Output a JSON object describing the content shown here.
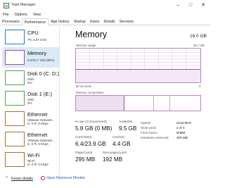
{
  "window": {
    "title": "Task Manager",
    "minimize": "–",
    "maximize": "□",
    "close": "✕"
  },
  "menu": [
    "File",
    "Options",
    "View"
  ],
  "tabs": [
    "Processes",
    "Performance",
    "App history",
    "Startup",
    "Users",
    "Details",
    "Services"
  ],
  "active_tab": "Performance",
  "sidebar": [
    {
      "name": "CPU",
      "sub1": "7%  3.67 GHz",
      "sub2": "",
      "color": "#1f78c1",
      "selected": false
    },
    {
      "name": "Memory",
      "sub1": "6.2/15.7 GB (39%)",
      "sub2": "",
      "color": "#9b4aa8",
      "selected": true
    },
    {
      "name": "Disk 0 (C: D:)",
      "sub1": "SSD",
      "sub2": "2%",
      "color": "#4da34d",
      "selected": false
    },
    {
      "name": "Disk 1 (E:)",
      "sub1": "SSD",
      "sub2": "0%",
      "color": "#4da34d",
      "selected": false
    },
    {
      "name": "Ethernet",
      "sub1": "VMware Network...",
      "sub2": "S: 0  R: 0 Kbps",
      "color": "#b06a2c",
      "selected": false
    },
    {
      "name": "Ethernet",
      "sub1": "VMware Network...",
      "sub2": "S: 0  R: 0 Kbps",
      "color": "#b06a2c",
      "selected": false
    },
    {
      "name": "Wi-Fi",
      "sub1": "Wi-Fi",
      "sub2": "S: 0  R: 0 Kbps",
      "color": "#b06a2c",
      "selected": false
    }
  ],
  "footer": {
    "fewer_details": "Fewer details",
    "open_resource_monitor": "Open Resource Monitor"
  },
  "main": {
    "title": "Memory",
    "total": "16.0 GB",
    "usage_label": "Memory usage",
    "usage_max": "15.7 GB",
    "usage_fraction": 0.39,
    "time_label": "60 seconds",
    "time_end": "0",
    "composition_label": "Memory composition",
    "composition_in_use_fraction": 0.39,
    "stats": {
      "in_use_label": "In use (Compressed)",
      "in_use_value": "5.8 GB (0 MB)",
      "available_label": "Available",
      "available_value": "9.5 GB",
      "committed_label": "Committed",
      "committed_value": "6.4/23.9 GB",
      "cached_label": "Cached",
      "cached_value": "4.4 GB",
      "paged_pool_label": "Paged pool",
      "paged_pool_value": "295 MB",
      "nonpaged_pool_label": "Non-paged pool",
      "nonpaged_pool_value": "192 MB"
    },
    "details": [
      {
        "key": "Speed:",
        "value": "2133 MHz"
      },
      {
        "key": "Slots used:",
        "value": "2 of 4"
      },
      {
        "key": "Form factor:",
        "value": "DIMM"
      },
      {
        "key": "Hardware reserved:",
        "value": "329 MB"
      }
    ]
  }
}
